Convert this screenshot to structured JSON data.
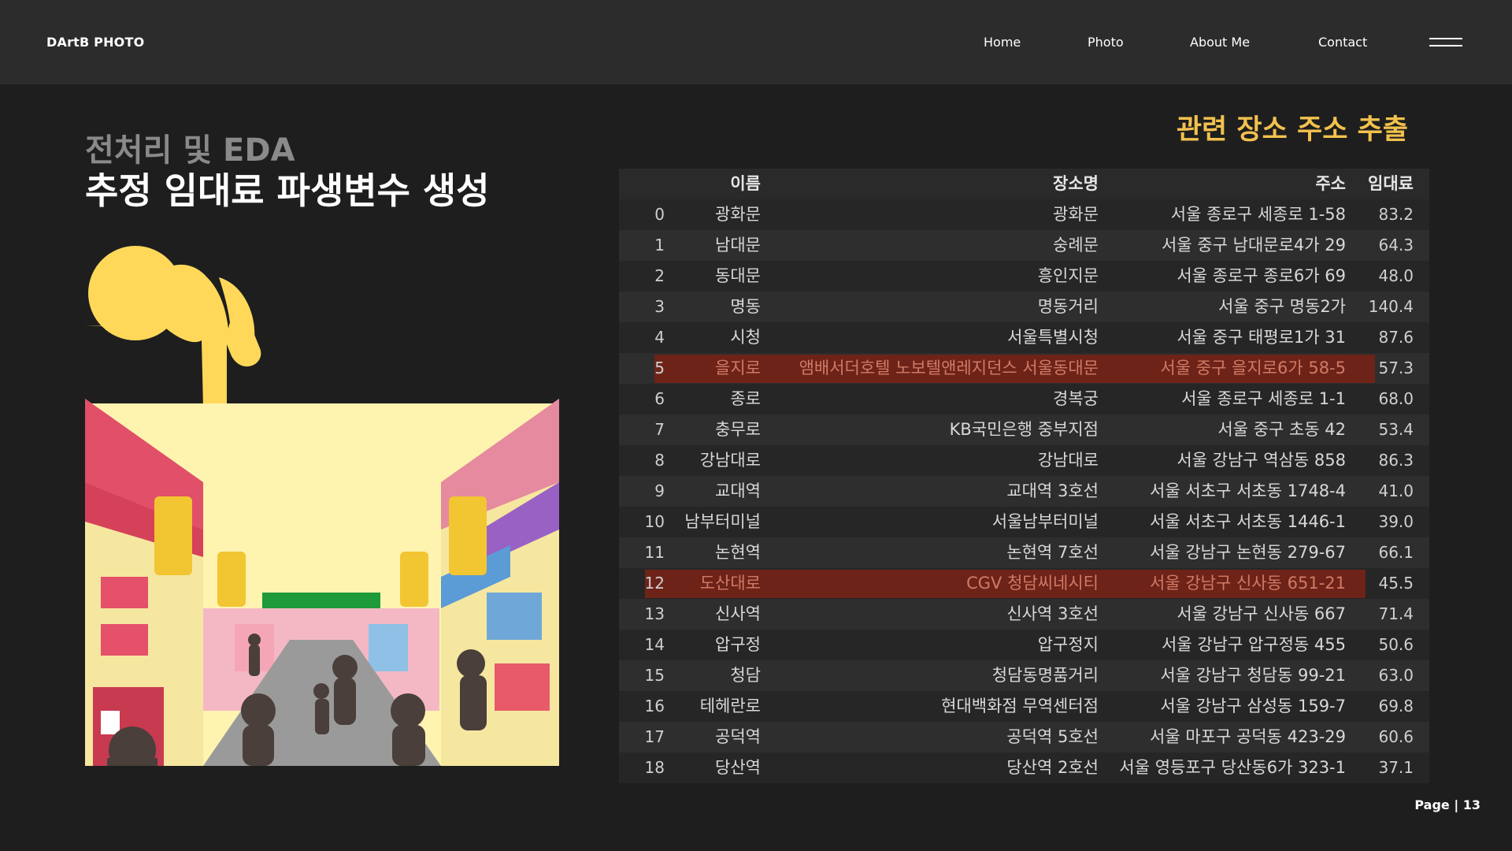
{
  "header": {
    "brand": "DArtB PHOTO",
    "nav": [
      "Home",
      "Photo",
      "About Me",
      "Contact"
    ]
  },
  "slide": {
    "subtitle": "전처리 및 EDA",
    "title": "추정 임대료 파생변수 생성",
    "table_title": "관련 장소 주소 추출",
    "page_label": "Page | 13"
  },
  "table": {
    "columns": [
      "",
      "이름",
      "장소명",
      "주소",
      "임대료"
    ],
    "highlight_color": "#6e2318",
    "rows": [
      {
        "idx": "0",
        "name": "광화문",
        "place": "광화문",
        "addr": "서울 종로구 세종로 1-58",
        "rent": "83.2"
      },
      {
        "idx": "1",
        "name": "남대문",
        "place": "숭례문",
        "addr": "서울 중구 남대문로4가 29",
        "rent": "64.3"
      },
      {
        "idx": "2",
        "name": "동대문",
        "place": "흥인지문",
        "addr": "서울 종로구 종로6가 69",
        "rent": "48.0"
      },
      {
        "idx": "3",
        "name": "명동",
        "place": "명동거리",
        "addr": "서울 중구 명동2가",
        "rent": "140.4"
      },
      {
        "idx": "4",
        "name": "시청",
        "place": "서울특별시청",
        "addr": "서울 중구 태평로1가 31",
        "rent": "87.6"
      },
      {
        "idx": "5",
        "name": "을지로",
        "place": "앰배서더호텔 노보텔앤레지던스 서울동대문",
        "addr": "서울 중구 을지로6가 58-5",
        "rent": "57.3",
        "highlight": true
      },
      {
        "idx": "6",
        "name": "종로",
        "place": "경복궁",
        "addr": "서울 종로구 세종로 1-1",
        "rent": "68.0"
      },
      {
        "idx": "7",
        "name": "충무로",
        "place": "KB국민은행 중부지점",
        "addr": "서울 중구 초동 42",
        "rent": "53.4"
      },
      {
        "idx": "8",
        "name": "강남대로",
        "place": "강남대로",
        "addr": "서울 강남구 역삼동 858",
        "rent": "86.3"
      },
      {
        "idx": "9",
        "name": "교대역",
        "place": "교대역 3호선",
        "addr": "서울 서초구 서초동 1748-4",
        "rent": "41.0"
      },
      {
        "idx": "10",
        "name": "남부터미널",
        "place": "서울남부터미널",
        "addr": "서울 서초구 서초동 1446-1",
        "rent": "39.0"
      },
      {
        "idx": "11",
        "name": "논현역",
        "place": "논현역 7호선",
        "addr": "서울 강남구 논현동 279-67",
        "rent": "66.1"
      },
      {
        "idx": "12",
        "name": "도산대로",
        "place": "CGV 청담씨네시티",
        "addr": "서울 강남구 신사동 651-21",
        "rent": "45.5",
        "highlight": true
      },
      {
        "idx": "13",
        "name": "신사역",
        "place": "신사역 3호선",
        "addr": "서울 강남구 신사동 667",
        "rent": "71.4"
      },
      {
        "idx": "14",
        "name": "압구정",
        "place": "압구정지",
        "addr": "서울 강남구 압구정동 455",
        "rent": "50.6"
      },
      {
        "idx": "15",
        "name": "청담",
        "place": "청담동명품거리",
        "addr": "서울 강남구 청담동 99-21",
        "rent": "63.0"
      },
      {
        "idx": "16",
        "name": "테헤란로",
        "place": "현대백화점 무역센터점",
        "addr": "서울 강남구 삼성동 159-7",
        "rent": "69.8"
      },
      {
        "idx": "17",
        "name": "공덕역",
        "place": "공덕역 5호선",
        "addr": "서울 마포구 공덕동 423-29",
        "rent": "60.6"
      },
      {
        "idx": "18",
        "name": "당산역",
        "place": "당산역 2호선",
        "addr": "서울 영등포구 당산동6가 323-1",
        "rent": "37.1"
      }
    ]
  },
  "illustration": {
    "icon": "pointing-hand-icon",
    "scene": "market-street-illustration"
  }
}
